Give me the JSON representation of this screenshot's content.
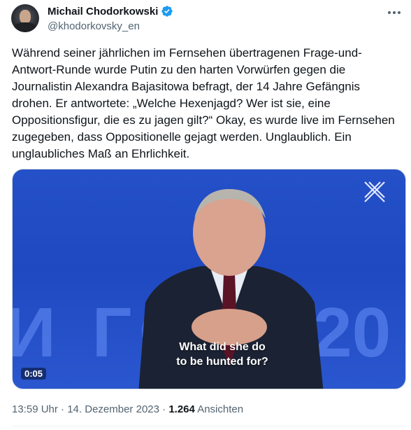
{
  "author": {
    "name": "Michail Chodorkowski",
    "handle": "@khodorkovsky_en",
    "verified": true,
    "avatar_icon": "profile-photo"
  },
  "tweet": {
    "text": "Während seiner jährlichen im Fernsehen übertragenen Frage-und-\nAntwort-Runde wurde Putin zu den harten Vorwürfen gegen die\nJournalistin Alexandra Bajasitowa befragt, der 14 Jahre Gefängnis\ndrohen. Er antwortete: „Welche Hexenjagd? Wer ist sie, eine\nOppositionsfigur, die es zu jagen gilt?“ Okay, es wurde live im Fernsehen\nzugegeben, dass Oppositionelle gejagt werden. Unglaublich. Ein\nunglaubliches Maß an Ehrlichkeit."
  },
  "media": {
    "subtitle_line1": "What did she do",
    "subtitle_line2": "to be hunted for?",
    "timer": "0:05",
    "background_text_left": "И ГО",
    "background_text_right": "20"
  },
  "meta": {
    "time": "13:59 Uhr",
    "separator": "·",
    "date": "14. Dezember 2023",
    "views_count": "1.264",
    "views_label": "Ansichten"
  },
  "colors": {
    "verified_blue": "#1d9bf0",
    "text_primary": "#0f1419",
    "text_secondary": "#536471",
    "video_blue": "#2450c8"
  }
}
